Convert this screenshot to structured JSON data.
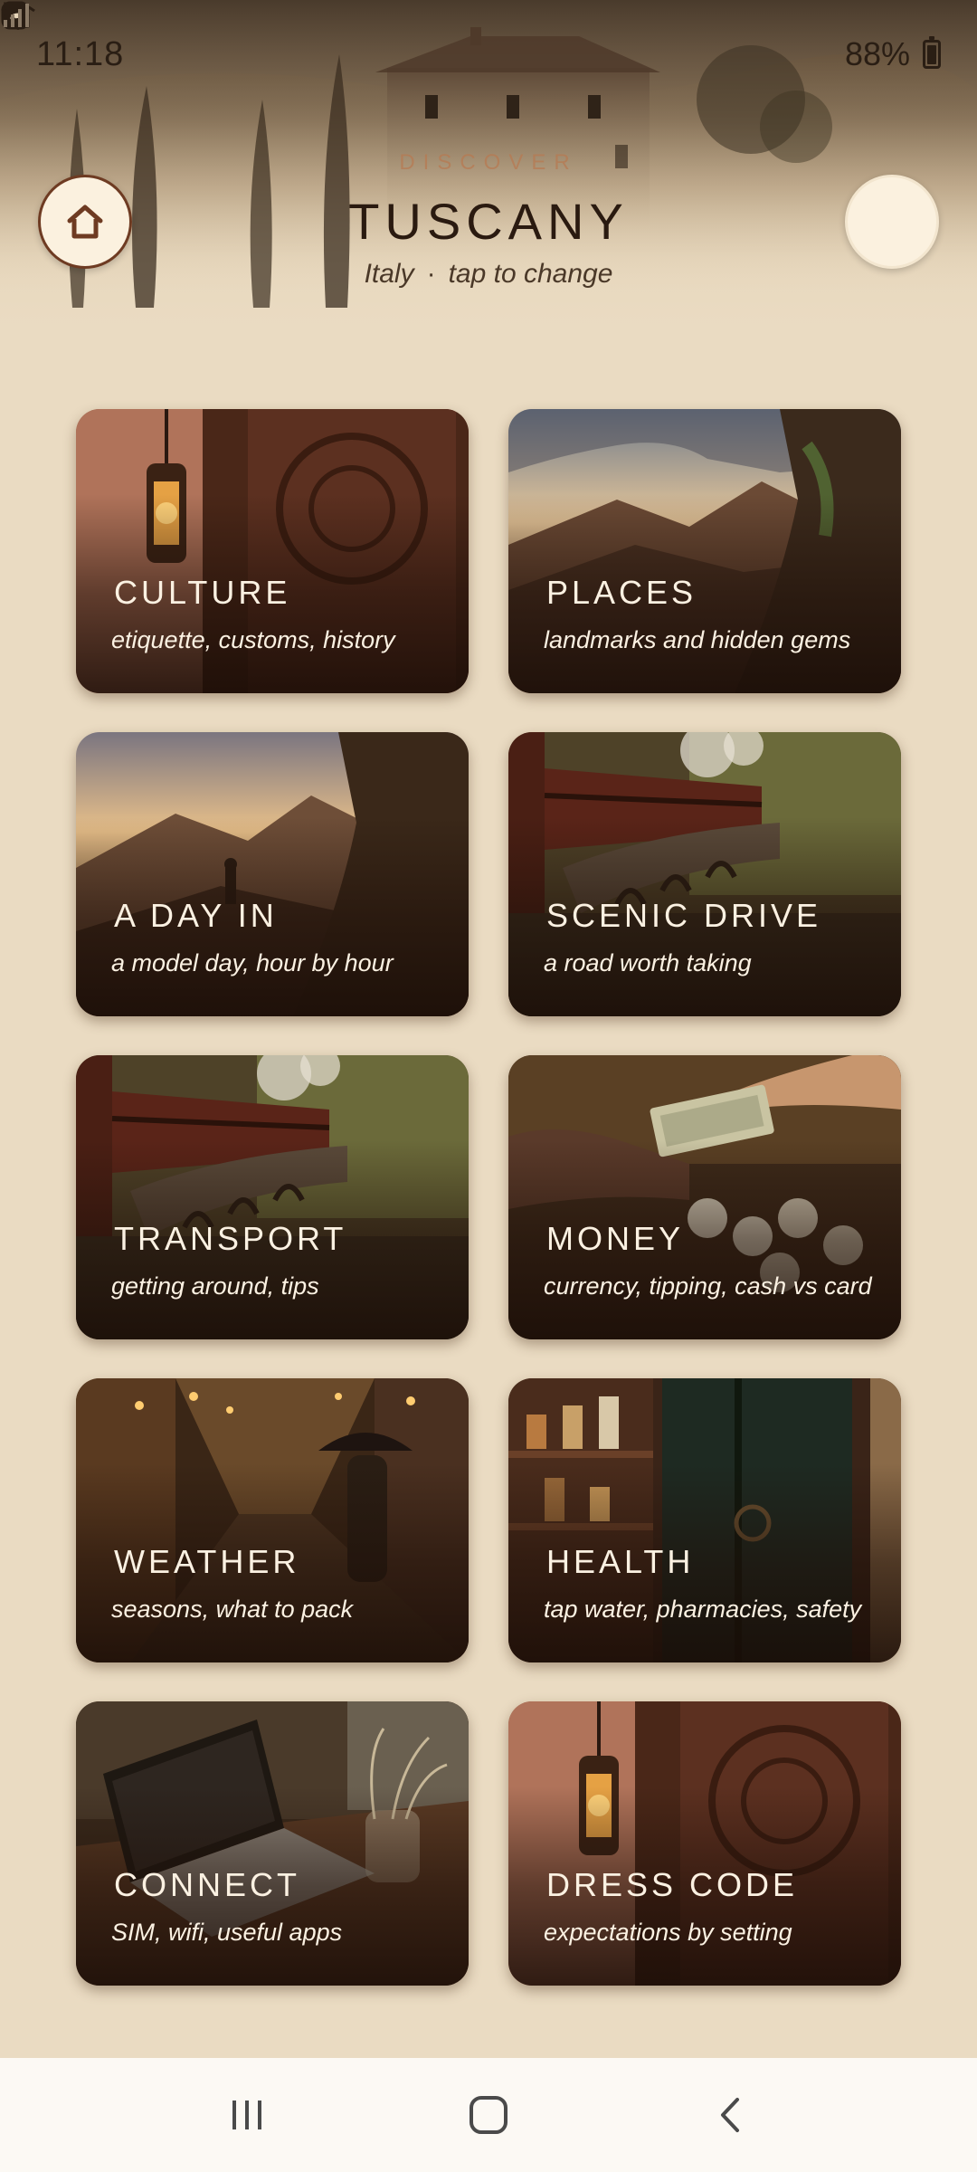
{
  "status_bar": {
    "time": "11:18",
    "battery": "88%",
    "left_icons": [
      "instagram-icon",
      "whatsapp-icon",
      "calendar-app-icon",
      "dot-icon"
    ],
    "right_icons": [
      "wifi-calling-icon",
      "call-signal-icon",
      "signal-icon",
      "battery-icon"
    ]
  },
  "header": {
    "kicker": "DISCOVER",
    "title": "TUSCANY",
    "country": "Italy",
    "separator": "·",
    "hint": "tap to change",
    "home_icon": "home-icon"
  },
  "cards": [
    {
      "title": "CULTURE",
      "subtitle": "etiquette, customs, history"
    },
    {
      "title": "PLACES",
      "subtitle": "landmarks and hidden gems"
    },
    {
      "title": "A DAY IN",
      "subtitle": "a model day, hour by hour"
    },
    {
      "title": "SCENIC DRIVE",
      "subtitle": "a road worth taking"
    },
    {
      "title": "TRANSPORT",
      "subtitle": "getting around, tips"
    },
    {
      "title": "MONEY",
      "subtitle": "currency, tipping, cash vs card"
    },
    {
      "title": "WEATHER",
      "subtitle": "seasons, what to pack"
    },
    {
      "title": "HEALTH",
      "subtitle": "tap water, pharmacies, safety"
    },
    {
      "title": "CONNECT",
      "subtitle": "SIM, wifi, useful apps"
    },
    {
      "title": "DRESS CODE",
      "subtitle": "expectations by setting"
    }
  ],
  "nav_bar": {
    "icons": [
      "recent-apps-icon",
      "home-nav-icon",
      "back-icon"
    ]
  },
  "colors": {
    "background": "#eadbc2",
    "accent": "#6e3b22",
    "card_text": "#fbf1e2"
  }
}
